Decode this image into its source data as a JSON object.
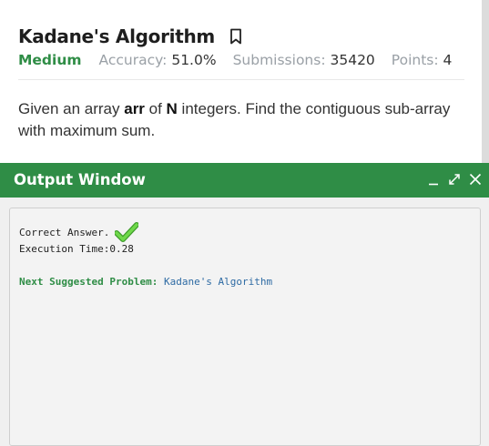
{
  "problem": {
    "title": "Kadane's Algorithm",
    "difficulty": "Medium",
    "accuracy_label": "Accuracy:",
    "accuracy_value": "51.0%",
    "submissions_label": "Submissions:",
    "submissions_value": "35420",
    "points_label": "Points:",
    "points_value": "4",
    "desc_part1": "Given an array ",
    "desc_arr": "arr",
    "desc_part2": " of ",
    "desc_n": "N",
    "desc_part3": " integers. Find the contiguous sub-array with maximum sum.",
    "bookmark_icon": "bookmark-icon"
  },
  "output_window": {
    "title": "Output Window",
    "controls": [
      "minimize-icon",
      "expand-icon",
      "close-icon"
    ],
    "correct_text": "Correct Answer.",
    "check_icon": "check-icon",
    "execution_time": "Execution Time:0.28",
    "next_label": "Next Suggested Problem:",
    "next_link": "Kadane's Algorithm"
  },
  "colors": {
    "brand_green": "#2f8d46",
    "link_blue": "#2d6aa3",
    "check_green": "#5cc93a"
  }
}
